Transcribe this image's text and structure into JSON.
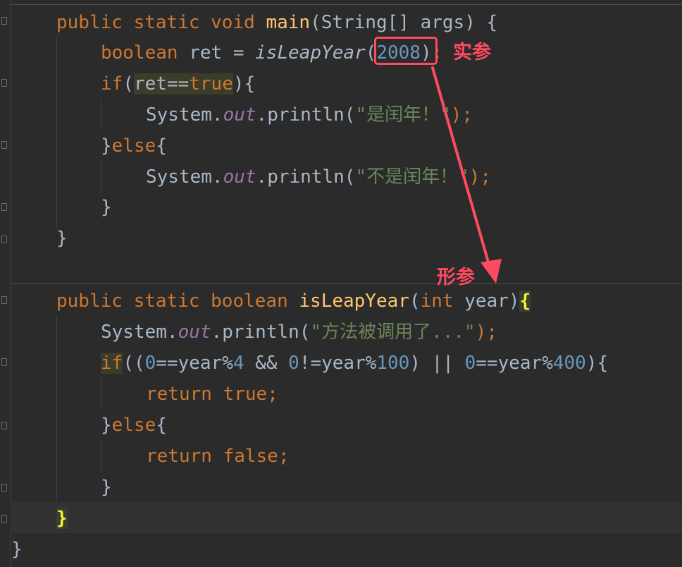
{
  "code": {
    "line_main": [
      "public",
      " ",
      "static",
      " ",
      "void",
      " ",
      "main",
      "(String[] args) {"
    ],
    "line_ret": [
      "boolean",
      " ret = ",
      "isLeapYear",
      "(",
      "2008",
      ")",
      ";"
    ],
    "line_if": [
      "if",
      "(",
      "ret",
      "==",
      "true",
      "){"
    ],
    "line_print1": [
      "System.",
      "out",
      ".println(",
      "\"是闰年！\"",
      ");"
    ],
    "line_else": [
      "}",
      "else",
      "{"
    ],
    "line_print2": [
      "System.",
      "out",
      ".println(",
      "\"不是闰年！\"",
      ");"
    ],
    "line_close_inner": "}",
    "line_close_main": "}",
    "line_sig": [
      "public",
      " ",
      "static",
      " ",
      "boolean",
      " ",
      "isLeapYear",
      "(",
      "int",
      " year)",
      "{"
    ],
    "line_print3": [
      "System.",
      "out",
      ".println(",
      "\"方法被调用了...\"",
      ");"
    ],
    "line_cond": [
      "if",
      "((",
      "0",
      "==year%",
      "4",
      " && ",
      "0",
      "!=year%",
      "100",
      ") || ",
      "0",
      "==year%",
      "400",
      "){"
    ],
    "line_ret_true": [
      "return",
      " ",
      "true",
      ";"
    ],
    "line_else2": [
      "}",
      "else",
      "{"
    ],
    "line_ret_false": [
      "return",
      " ",
      "false",
      ";"
    ],
    "line_close_inner2": "}",
    "line_close_method": "}",
    "line_close_class": "}"
  },
  "annotations": {
    "actual_param": "实参",
    "formal_param": "形参"
  },
  "colors": {
    "background": "#2b2b2b",
    "keyword": "#cc7832",
    "function": "#ffc66d",
    "number": "#6897bb",
    "string": "#6a8759",
    "field": "#9876aa",
    "plain": "#a9b7c6",
    "annotation": "#ff4a62"
  }
}
